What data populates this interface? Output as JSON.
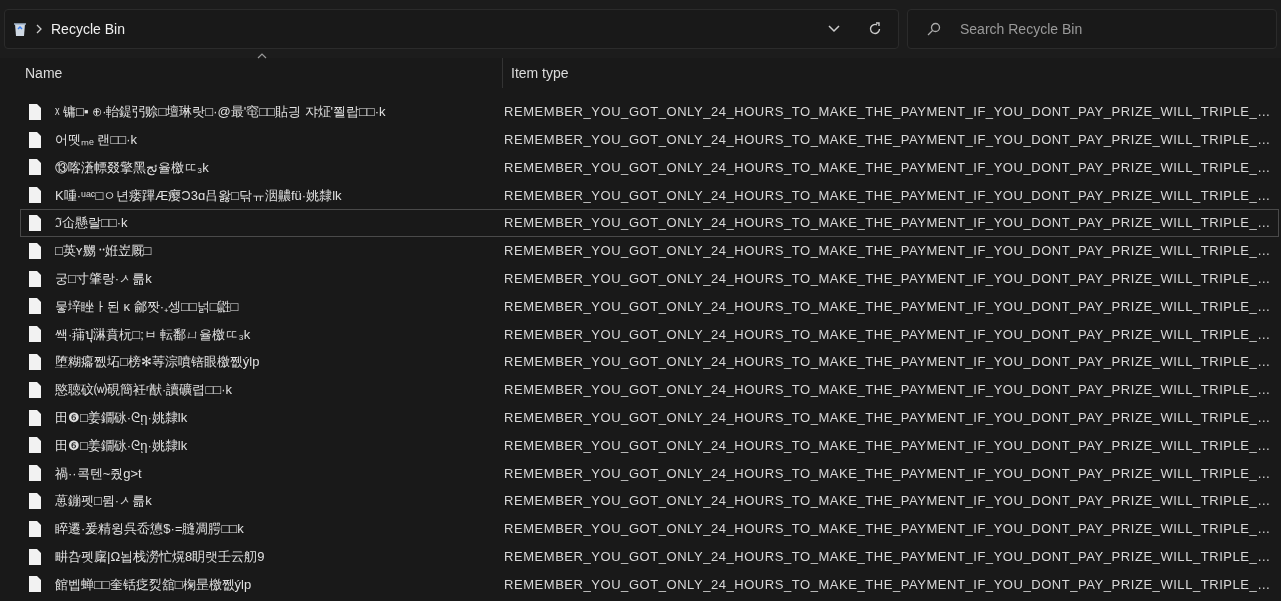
{
  "address_bar": {
    "location": "Recycle Bin"
  },
  "search": {
    "placeholder": "Search Recycle Bin"
  },
  "columns": [
    {
      "label": "Name",
      "sorted": true
    },
    {
      "label": "Item type",
      "sorted": false
    }
  ],
  "files": [
    {
      "name": "ᵡ 镛□▪ ⊕·軩鍉弜赊□壇琳랏□·@最'窀□□貼긩 쟈炡'쬘랍□□·k",
      "type": "REMEMBER_YOU_GOT_ONLY_24_HOURS_TO_MAKE_THE_PAYMENT_IF_YOU_DONT_PAY_PRIZE_WILL_TRIPLE_…",
      "focused": false
    },
    {
      "name": "어뗏ₘₑ 랜□□·k",
      "type": "REMEMBER_YOU_GOT_ONLY_24_HOURS_TO_MAKE_THE_PAYMENT_IF_YOU_DONT_PAY_PRIZE_WILL_TRIPLE_…",
      "focused": false
    },
    {
      "name": "⑬喀濸幖叕擎黑ئج율檄ㄸ₃k",
      "type": "REMEMBER_YOU_GOT_ONLY_24_HOURS_TO_MAKE_THE_PAYMENT_IF_YOU_DONT_PAY_PRIZE_WILL_TRIPLE_…",
      "focused": false
    },
    {
      "name": "K喠·ᵘᵃᶜ□ㅇ년瘘蹕Æ瘿Ɔ3ɑ吕왏□닦ㅠ洇齈fü·姚隸lk",
      "type": "REMEMBER_YOU_GOT_ONLY_24_HOURS_TO_MAKE_THE_PAYMENT_IF_YOU_DONT_PAY_PRIZE_WILL_TRIPLE_…",
      "focused": false
    },
    {
      "name": "ℑ仚懸랄□□·k",
      "type": "REMEMBER_YOU_GOT_ONLY_24_HOURS_TO_MAKE_THE_PAYMENT_IF_YOU_DONT_PAY_PRIZE_WILL_TRIPLE_…",
      "focused": true
    },
    {
      "name": "□英ʏ嬲᠃姙岦厩□",
      "type": "REMEMBER_YOU_GOT_ONLY_24_HOURS_TO_MAKE_THE_PAYMENT_IF_YOU_DONT_PAY_PRIZE_WILL_TRIPLE_…",
      "focused": false
    },
    {
      "name": "궁□寸肇랑·ᄼ륾k",
      "type": "REMEMBER_YOU_GOT_ONLY_24_HOURS_TO_MAKE_THE_PAYMENT_IF_YOU_DONT_PAY_PRIZE_WILL_TRIPLE_…",
      "focused": false
    },
    {
      "name": "뭏垶睉ㅏ된 ĸ 鄃짯·₊셍□□넑□鼪□",
      "type": "REMEMBER_YOU_GOT_ONLY_24_HOURS_TO_MAKE_THE_PAYMENT_IF_YOU_DONT_PAY_PRIZE_WILL_TRIPLE_…",
      "focused": false
    },
    {
      "name": "쌕·蒱ปุ㵉賁杬□;ㅂ 転鄱ㄩ율檄ㄸ₃k",
      "type": "REMEMBER_YOU_GOT_ONLY_24_HOURS_TO_MAKE_THE_PAYMENT_IF_YOU_DONT_PAY_PRIZE_WILL_TRIPLE_…",
      "focused": false
    },
    {
      "name": "堕糊癟쩺坧□榜✻䓁淙噴锫眼檄쩺ýlp",
      "type": "REMEMBER_YOU_GOT_ONLY_24_HOURS_TO_MAKE_THE_PAYMENT_IF_YOU_DONT_PAY_PRIZE_WILL_TRIPLE_…",
      "focused": false
    },
    {
      "name": "愍聴砇⒲硯簡衽ʳ猷·讀礦렵□□·k",
      "type": "REMEMBER_YOU_GOT_ONLY_24_HOURS_TO_MAKE_THE_PAYMENT_IF_YOU_DONT_PAY_PRIZE_WILL_TRIPLE_…",
      "focused": false
    },
    {
      "name": "田❻□姜鐗砯·ᘓῃ·姚隸lk",
      "type": "REMEMBER_YOU_GOT_ONLY_24_HOURS_TO_MAKE_THE_PAYMENT_IF_YOU_DONT_PAY_PRIZE_WILL_TRIPLE_…",
      "focused": false
    },
    {
      "name": "田❻□姜鐗砯·ᘓῃ·姚隸lk",
      "type": "REMEMBER_YOU_GOT_ONLY_24_HOURS_TO_MAKE_THE_PAYMENT_IF_YOU_DONT_PAY_PRIZE_WILL_TRIPLE_…",
      "focused": false
    },
    {
      "name": "禍··콕텐~줬g>t",
      "type": "REMEMBER_YOU_GOT_ONLY_24_HOURS_TO_MAKE_THE_PAYMENT_IF_YOU_DONT_PAY_PRIZE_WILL_TRIPLE_…",
      "focused": false
    },
    {
      "name": "葸鏰펫□뮘·ᄼ륾k",
      "type": "REMEMBER_YOU_GOT_ONLY_24_HOURS_TO_MAKE_THE_PAYMENT_IF_YOU_DONT_PAY_PRIZE_WILL_TRIPLE_…",
      "focused": false
    },
    {
      "name": "睟遷·爰精윙呉岙憄$·=膖凋腭□□k",
      "type": "REMEMBER_YOU_GOT_ONLY_24_HOURS_TO_MAKE_THE_PAYMENT_IF_YOU_DONT_PAY_PRIZE_WILL_TRIPLE_…",
      "focused": false
    },
    {
      "name": "畊叴펫廜|Ω뇝栈澇忙熀8眀랫壬云舠9",
      "type": "REMEMBER_YOU_GOT_ONLY_24_HOURS_TO_MAKE_THE_PAYMENT_IF_YOU_DONT_PAY_PRIZE_WILL_TRIPLE_…",
      "focused": false
    },
    {
      "name": "館벱蝉□□奎铦疺烮舘□椈昰檄쩺ýlp",
      "type": "REMEMBER_YOU_GOT_ONLY_24_HOURS_TO_MAKE_THE_PAYMENT_IF_YOU_DONT_PAY_PRIZE_WILL_TRIPLE_…",
      "focused": false
    }
  ]
}
